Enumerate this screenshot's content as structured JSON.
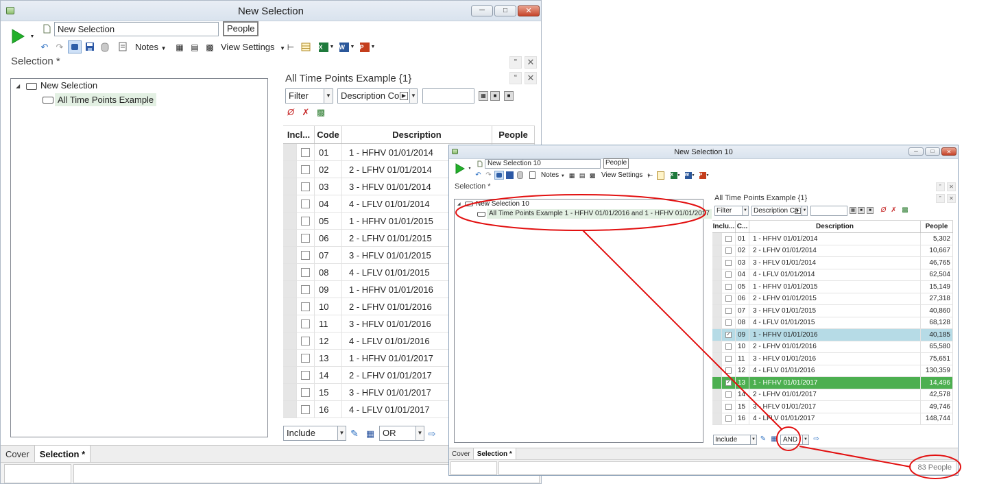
{
  "main": {
    "title": "New Selection",
    "selection_name": "New Selection",
    "unit_chip": "People",
    "notes_label": "Notes",
    "view_settings_label": "View Settings",
    "section_title": "Selection *",
    "tree_root": "New Selection",
    "tree_child": "All Time Points Example",
    "panel_title": "All Time Points Example {1}",
    "filter_value": "Filter",
    "description_mode": "Description Co",
    "grid_headers": {
      "include": "Incl...",
      "code": "Code",
      "description": "Description",
      "people": "People"
    },
    "rows": [
      {
        "code": "01",
        "desc": "1 - HFHV 01/01/2014"
      },
      {
        "code": "02",
        "desc": "2 - LFHV 01/01/2014"
      },
      {
        "code": "03",
        "desc": "3 - HFLV 01/01/2014"
      },
      {
        "code": "04",
        "desc": "4 - LFLV 01/01/2014"
      },
      {
        "code": "05",
        "desc": "1 - HFHV 01/01/2015"
      },
      {
        "code": "06",
        "desc": "2 - LFHV 01/01/2015"
      },
      {
        "code": "07",
        "desc": "3 - HFLV 01/01/2015"
      },
      {
        "code": "08",
        "desc": "4 - LFLV 01/01/2015"
      },
      {
        "code": "09",
        "desc": "1 - HFHV 01/01/2016"
      },
      {
        "code": "10",
        "desc": "2 - LFHV 01/01/2016"
      },
      {
        "code": "11",
        "desc": "3 - HFLV 01/01/2016"
      },
      {
        "code": "12",
        "desc": "4 - LFLV 01/01/2016"
      },
      {
        "code": "13",
        "desc": "1 - HFHV 01/01/2017"
      },
      {
        "code": "14",
        "desc": "2 - LFHV 01/01/2017"
      },
      {
        "code": "15",
        "desc": "3 - HFLV 01/01/2017"
      },
      {
        "code": "16",
        "desc": "4 - LFLV 01/01/2017"
      }
    ],
    "include_value": "Include",
    "operator_value": "OR",
    "tabs": [
      "Cover",
      "Selection *"
    ]
  },
  "popup": {
    "title": "New Selection 10",
    "selection_name": "New Selection 10",
    "unit_chip": "People",
    "notes_label": "Notes",
    "view_settings_label": "View Settings",
    "section_title": "Selection *",
    "tree_root": "New Selection 10",
    "tree_child": "All Time Points Example  1 - HFHV 01/01/2016 and  1 - HFHV 01/01/2017",
    "panel_title": "All Time Points Example {1}",
    "filter_value": "Filter",
    "description_mode": "Description Co",
    "grid_headers": {
      "include": "Inclu...",
      "code": "C...",
      "description": "Description",
      "people": "People"
    },
    "rows": [
      {
        "code": "01",
        "desc": "1 - HFHV 01/01/2014",
        "people": "5,302",
        "checked": false,
        "state": ""
      },
      {
        "code": "02",
        "desc": "2 - LFHV 01/01/2014",
        "people": "10,667",
        "checked": false,
        "state": ""
      },
      {
        "code": "03",
        "desc": "3 - HFLV 01/01/2014",
        "people": "46,765",
        "checked": false,
        "state": ""
      },
      {
        "code": "04",
        "desc": "4 - LFLV 01/01/2014",
        "people": "62,504",
        "checked": false,
        "state": ""
      },
      {
        "code": "05",
        "desc": "1 - HFHV 01/01/2015",
        "people": "15,149",
        "checked": false,
        "state": ""
      },
      {
        "code": "06",
        "desc": "2 - LFHV 01/01/2015",
        "people": "27,318",
        "checked": false,
        "state": ""
      },
      {
        "code": "07",
        "desc": "3 - HFLV 01/01/2015",
        "people": "40,860",
        "checked": false,
        "state": ""
      },
      {
        "code": "08",
        "desc": "4 - LFLV 01/01/2015",
        "people": "68,128",
        "checked": false,
        "state": ""
      },
      {
        "code": "09",
        "desc": "1 - HFHV 01/01/2016",
        "people": "40,185",
        "checked": true,
        "state": "checked"
      },
      {
        "code": "10",
        "desc": "2 - LFHV 01/01/2016",
        "people": "65,580",
        "checked": false,
        "state": ""
      },
      {
        "code": "11",
        "desc": "3 - HFLV 01/01/2016",
        "people": "75,651",
        "checked": false,
        "state": ""
      },
      {
        "code": "12",
        "desc": "4 - LFLV 01/01/2016",
        "people": "130,359",
        "checked": false,
        "state": ""
      },
      {
        "code": "13",
        "desc": "1 - HFHV 01/01/2017",
        "people": "14,496",
        "checked": true,
        "state": "selected"
      },
      {
        "code": "14",
        "desc": "2 - LFHV 01/01/2017",
        "people": "42,578",
        "checked": false,
        "state": ""
      },
      {
        "code": "15",
        "desc": "3 - HFLV 01/01/2017",
        "people": "49,746",
        "checked": false,
        "state": ""
      },
      {
        "code": "16",
        "desc": "4 - LFLV 01/01/2017",
        "people": "148,744",
        "checked": false,
        "state": ""
      }
    ],
    "include_value": "Include",
    "operator_value": "AND",
    "tabs": [
      "Cover",
      "Selection *"
    ],
    "count_status": "83 People"
  },
  "colors": {
    "selected_row": "#4caf50",
    "checked_row": "#b6dbe6",
    "annotation": "#e21010",
    "tree_highlight": "#e3f0e3"
  },
  "icons": [
    "run-icon",
    "new-document-icon",
    "undo-icon",
    "redo-icon",
    "save-icon",
    "database-icon",
    "notes-icon",
    "excel-icon",
    "word-icon",
    "powerpoint-icon",
    "pin-icon",
    "close-icon",
    "clear-filter-icon"
  ]
}
